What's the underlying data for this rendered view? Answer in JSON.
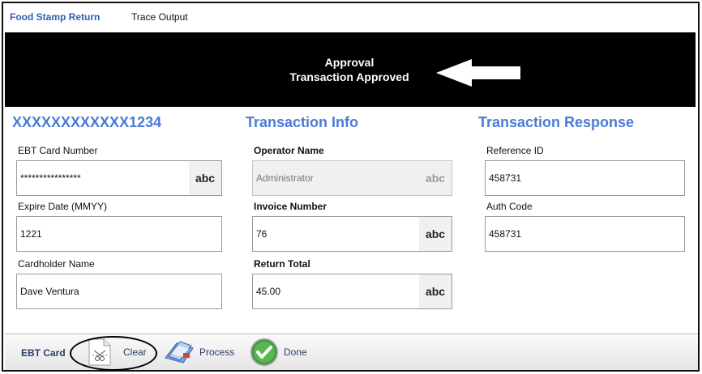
{
  "tabs": [
    {
      "label": "Food Stamp Return",
      "active": true
    },
    {
      "label": "Trace Output",
      "active": false
    }
  ],
  "banner": {
    "line1": "Approval",
    "line2": "Transaction Approved"
  },
  "sections": {
    "card_heading": "XXXXXXXXXXXX1234",
    "info_heading": "Transaction Info",
    "response_heading": "Transaction Response"
  },
  "card": {
    "ebt_label": "EBT Card Number",
    "ebt_value": "****************",
    "expire_label": "Expire Date (MMYY)",
    "expire_value": "1221",
    "name_label": "Cardholder Name",
    "name_value": "Dave Ventura"
  },
  "info": {
    "operator_label": "Operator Name",
    "operator_value": "Administrator",
    "invoice_label": "Invoice Number",
    "invoice_value": "76",
    "total_label": "Return Total",
    "total_value": "45.00"
  },
  "response": {
    "ref_label": "Reference ID",
    "ref_value": "458731",
    "auth_label": "Auth Code",
    "auth_value": "458731"
  },
  "keyboard_label": "abc",
  "toolbar": {
    "title": "EBT Card",
    "clear_label": "Clear",
    "process_label": "Process",
    "done_label": "Done"
  },
  "colors": {
    "heading": "#4a7bd6",
    "active_tab": "#2f5fb3",
    "banner_bg": "#000000",
    "done_green": "#3a9a3a"
  }
}
